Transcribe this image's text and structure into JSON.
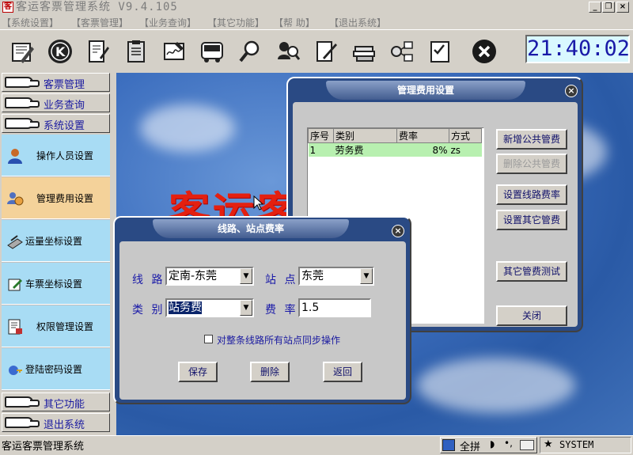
{
  "app": {
    "title": "客运客票管理系统 V9.4.105"
  },
  "menu": {
    "items": [
      "【系统设置】",
      "【客票管理】",
      "【业务查询】",
      "【其它功能】",
      "【帮 助】",
      "【退出系统】"
    ]
  },
  "toolbar": {
    "icons": [
      "edit-icon",
      "k-logo-icon",
      "document-tool-icon",
      "clipboard-icon",
      "signature-icon",
      "bus-icon",
      "magnifier-icon",
      "people-search-icon",
      "pen-icon",
      "books-icon",
      "network-icon",
      "checklist-icon",
      "close-circle-icon"
    ]
  },
  "clock": "21:40:02",
  "sidebar": {
    "top": [
      {
        "label": "客票管理"
      },
      {
        "label": "业务查询"
      },
      {
        "label": "系统设置"
      }
    ],
    "sub": [
      {
        "label": "操作人员设置"
      },
      {
        "label": "管理费用设置"
      },
      {
        "label": "运量坐标设置"
      },
      {
        "label": "车票坐标设置"
      },
      {
        "label": "权限管理设置"
      },
      {
        "label": "登陆密码设置"
      }
    ],
    "bottom": [
      {
        "label": "其它功能"
      },
      {
        "label": "退出系统"
      }
    ]
  },
  "desktop": {
    "banner": "客运客"
  },
  "fee_dialog": {
    "title": "管理费用设置",
    "columns": [
      "序号",
      "类别",
      "费率",
      "方式"
    ],
    "rows": [
      {
        "no": "1",
        "type": "劳务费",
        "rate": "8%",
        "mode": "zs"
      }
    ],
    "buttons": {
      "add_public": "新增公共管费",
      "delete_public": "删除公共管费",
      "set_route": "设置线路费率",
      "set_other": "设置其它管费",
      "test_other": "其它管费测试",
      "close": "关闭"
    }
  },
  "rate_dialog": {
    "title": "线路、站点费率",
    "route_label": "线 路",
    "route_value": "定南-东莞",
    "station_label": "站 点",
    "station_value": "东莞",
    "type_label": "类 别",
    "type_value": "站务费",
    "rate_label": "费 率",
    "rate_value": "1.5",
    "sync_label": "对整条线路所有站点同步操作",
    "save": "保存",
    "delete": "删除",
    "back": "返回"
  },
  "status": {
    "text": "客运客票管理系统",
    "ime": "全拼",
    "user": "SYSTEM"
  }
}
